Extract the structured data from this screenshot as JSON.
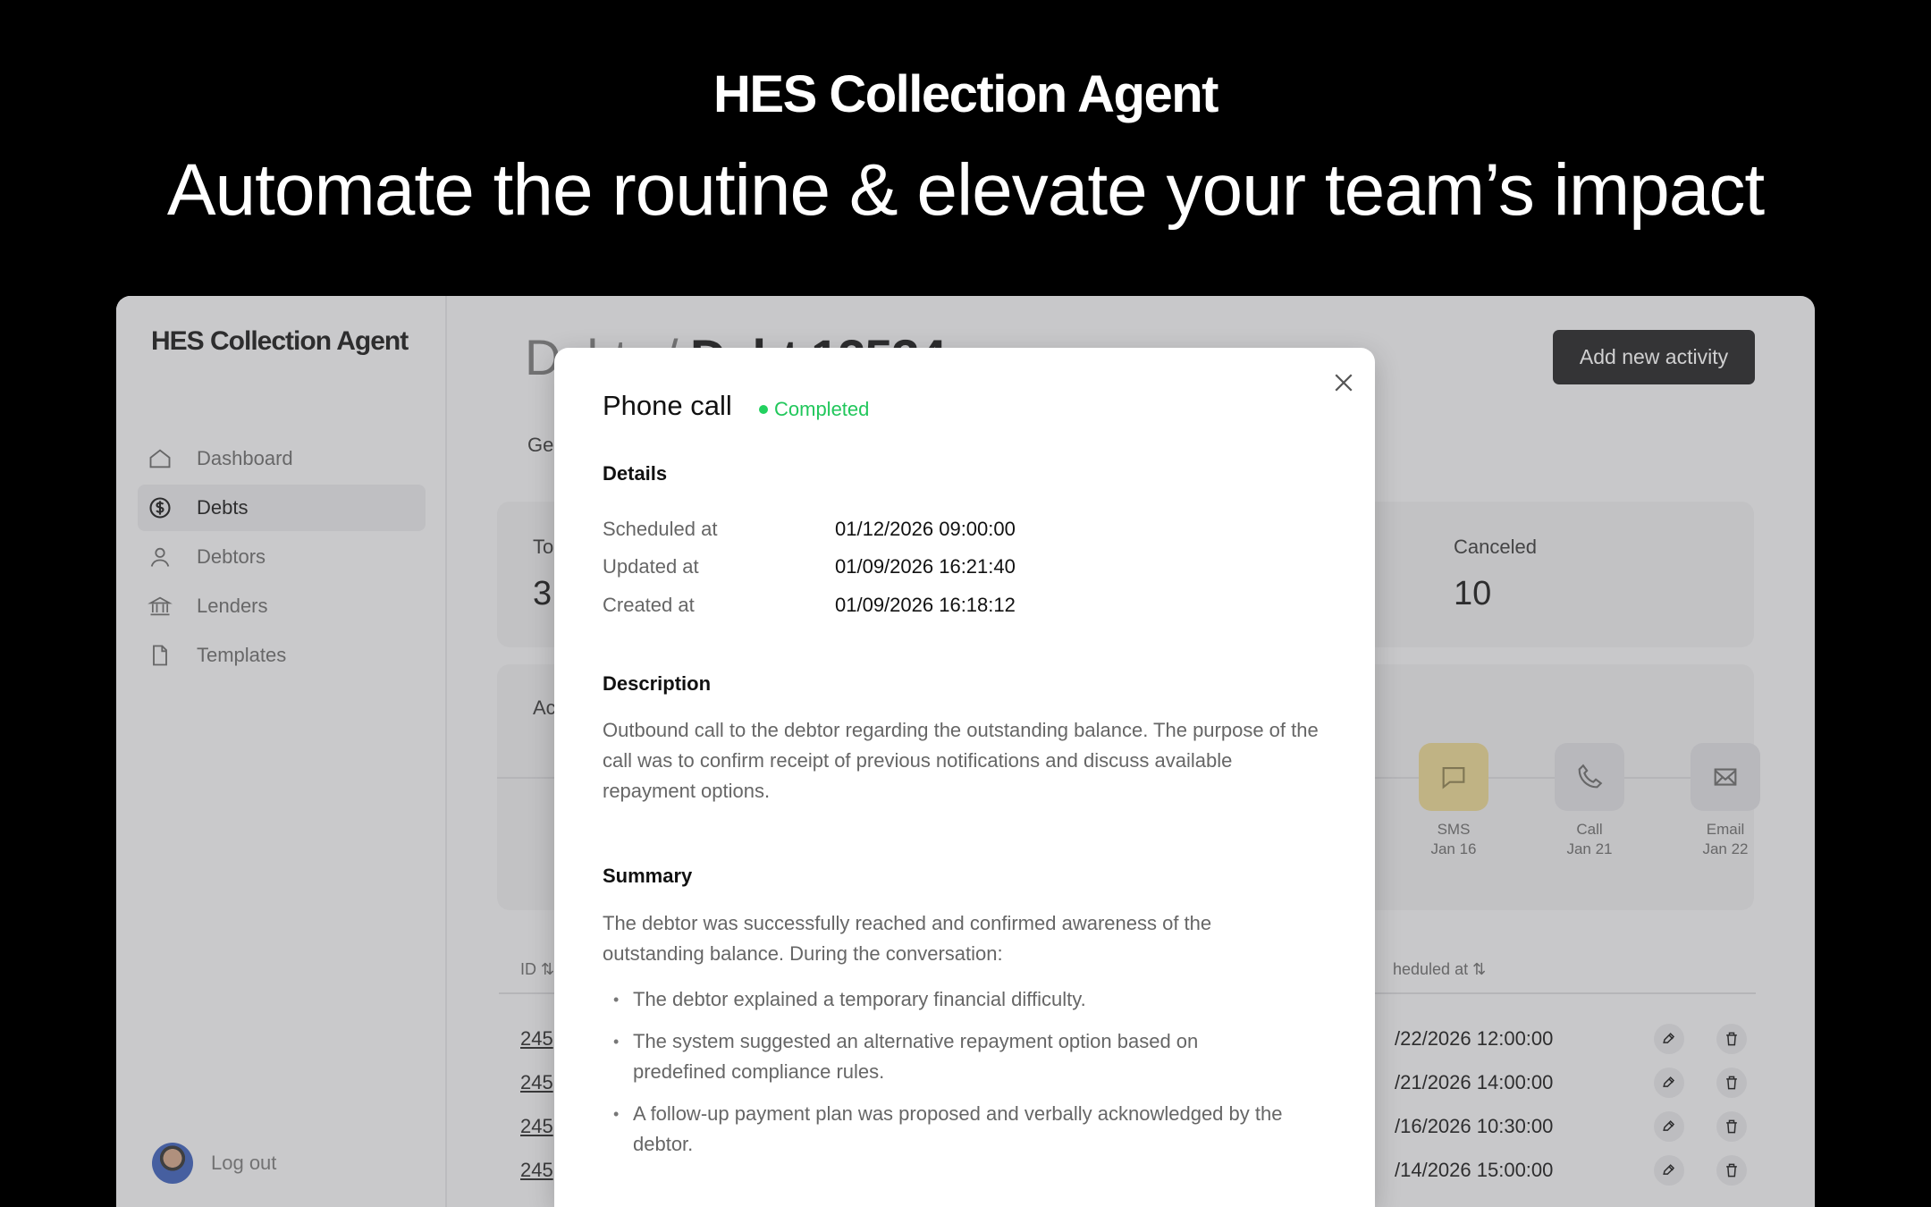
{
  "hero": {
    "brand": "HES Collection Agent",
    "tagline": "Automate the routine & elevate your team’s impact"
  },
  "sidebar": {
    "brand": "HES Collection Agent",
    "items": [
      {
        "label": "Dashboard",
        "icon": "home-icon"
      },
      {
        "label": "Debts",
        "icon": "dollar-circle-icon",
        "active": true
      },
      {
        "label": "Debtors",
        "icon": "user-icon"
      },
      {
        "label": "Lenders",
        "icon": "bank-icon"
      },
      {
        "label": "Templates",
        "icon": "document-icon"
      }
    ],
    "logout": "Log out"
  },
  "main": {
    "title_prefix": "Debts / ",
    "title_current": "Debt 12534",
    "add_button": "Add new activity",
    "tab_partial": "Ge",
    "summary": {
      "left_label_partial": "To",
      "left_value_partial": "3",
      "canceled_label": "Canceled",
      "canceled_value": "10"
    },
    "activity": {
      "title_partial": "Ac",
      "timeline": [
        {
          "type": "SMS",
          "date": "Jan 16",
          "icon": "message-icon",
          "color": "#e9d690"
        },
        {
          "type": "Call",
          "date": "Jan 21",
          "icon": "phone-icon",
          "color": "#dedee2"
        },
        {
          "type": "Email",
          "date": "Jan 22",
          "icon": "mail-icon",
          "color": "#dedee2"
        }
      ]
    },
    "table": {
      "columns": [
        "ID",
        "heduled at"
      ],
      "rows": [
        {
          "id": "245",
          "scheduled_at": "/22/2026  12:00:00"
        },
        {
          "id": "245",
          "scheduled_at": "/21/2026  14:00:00"
        },
        {
          "id": "245",
          "scheduled_at": "/16/2026  10:30:00"
        },
        {
          "id": "245",
          "scheduled_at": "/14/2026  15:00:00"
        }
      ]
    }
  },
  "modal": {
    "title": "Phone call",
    "status": "Completed",
    "details_title": "Details",
    "details": [
      {
        "label": "Scheduled at",
        "value": "01/12/2026  09:00:00"
      },
      {
        "label": "Updated at",
        "value": "01/09/2026  16:21:40"
      },
      {
        "label": "Created at",
        "value": "01/09/2026  16:18:12"
      }
    ],
    "description_title": "Description",
    "description": "Outbound call to the debtor regarding the outstanding balance. The purpose of the call was to confirm receipt of previous notifications and discuss available repayment options.",
    "summary_title": "Summary",
    "summary_intro": "The debtor was successfully reached and confirmed awareness of the outstanding balance. During the conversation:",
    "summary_points": [
      "The debtor explained a temporary financial difficulty.",
      "The system suggested an alternative repayment option based on predefined compliance rules.",
      "A follow-up payment plan was proposed and verbally acknowledged by the debtor."
    ]
  },
  "colors": {
    "accent": "#22d15f",
    "background": "#000000",
    "panel": "#f5f5f6",
    "button": "#1b1b1d"
  }
}
